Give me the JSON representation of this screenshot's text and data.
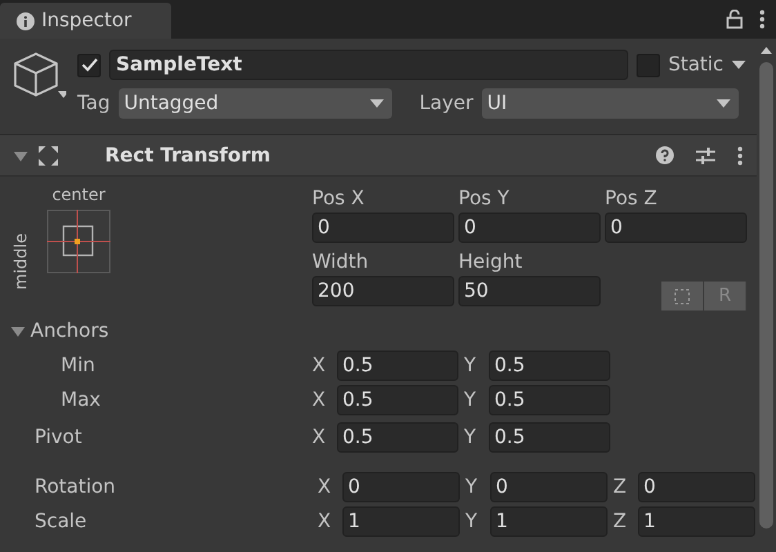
{
  "tab": {
    "title": "Inspector"
  },
  "object": {
    "active": true,
    "name": "SampleText",
    "static": false,
    "static_label": "Static",
    "tag_label": "Tag",
    "tag": "Untagged",
    "layer_label": "Layer",
    "layer": "UI"
  },
  "component": {
    "title": "Rect Transform",
    "expanded": true,
    "anchor_preset": {
      "horizontal": "center",
      "vertical": "middle"
    },
    "pos_fields": [
      {
        "label": "Pos X",
        "value": "0"
      },
      {
        "label": "Pos Y",
        "value": "0"
      },
      {
        "label": "Pos Z",
        "value": "0"
      }
    ],
    "size_fields": [
      {
        "label": "Width",
        "value": "200"
      },
      {
        "label": "Height",
        "value": "50"
      }
    ],
    "raw_edit_label": "R",
    "anchors": {
      "label": "Anchors",
      "expanded": true,
      "rows": [
        {
          "label": "Min",
          "fields": [
            {
              "axis": "X",
              "value": "0.5"
            },
            {
              "axis": "Y",
              "value": "0.5"
            }
          ]
        },
        {
          "label": "Max",
          "fields": [
            {
              "axis": "X",
              "value": "0.5"
            },
            {
              "axis": "Y",
              "value": "0.5"
            }
          ]
        }
      ]
    },
    "rows": [
      {
        "label": "Pivot",
        "fields": [
          {
            "axis": "X",
            "value": "0.5"
          },
          {
            "axis": "Y",
            "value": "0.5"
          }
        ]
      },
      {
        "label": "Rotation",
        "fields": [
          {
            "axis": "X",
            "value": "0"
          },
          {
            "axis": "Y",
            "value": "0"
          },
          {
            "axis": "Z",
            "value": "0"
          }
        ]
      },
      {
        "label": "Scale",
        "fields": [
          {
            "axis": "X",
            "value": "1"
          },
          {
            "axis": "Y",
            "value": "1"
          },
          {
            "axis": "Z",
            "value": "1"
          }
        ]
      }
    ]
  }
}
